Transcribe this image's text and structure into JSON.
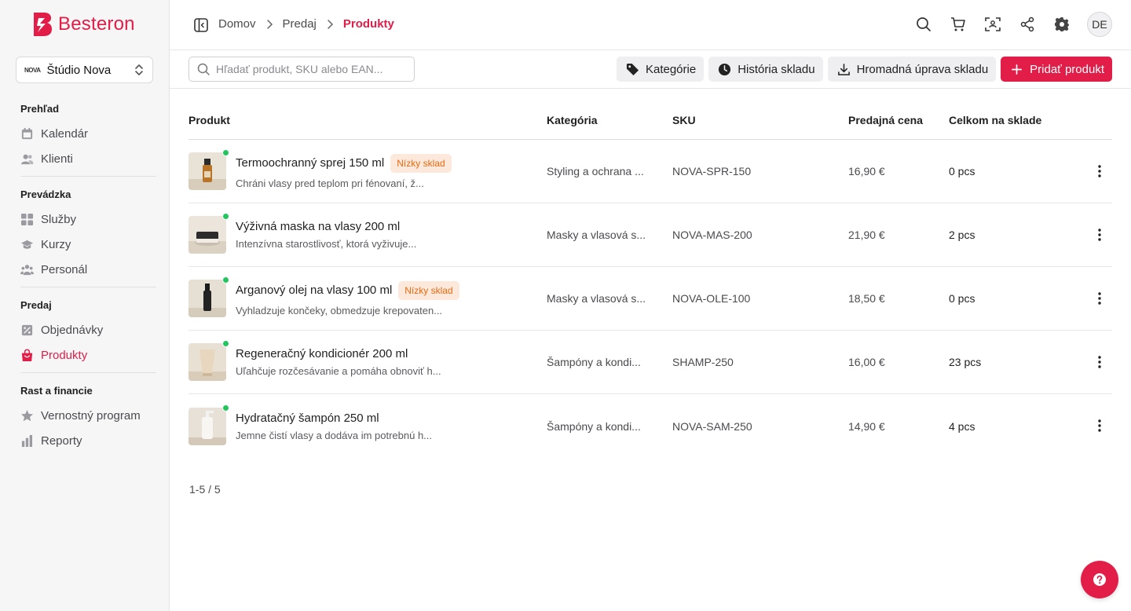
{
  "app": {
    "brand": "Besteron",
    "brand_color": "#e11d48"
  },
  "studio": {
    "logo_text": "NOVA",
    "name": "Štúdio Nova"
  },
  "sidebar": {
    "sections": [
      {
        "title": "Prehľad",
        "items": [
          {
            "label": "Kalendár",
            "icon": "calendar-icon"
          },
          {
            "label": "Klienti",
            "icon": "users-icon"
          }
        ]
      },
      {
        "title": "Prevádzka",
        "items": [
          {
            "label": "Služby",
            "icon": "grid-icon"
          },
          {
            "label": "Kurzy",
            "icon": "graduation-icon"
          },
          {
            "label": "Personál",
            "icon": "team-icon"
          }
        ]
      },
      {
        "title": "Predaj",
        "items": [
          {
            "label": "Objednávky",
            "icon": "orders-icon"
          },
          {
            "label": "Produkty",
            "icon": "shopping-bag-icon",
            "active": true
          }
        ]
      },
      {
        "title": "Rast a financie",
        "items": [
          {
            "label": "Vernostný program",
            "icon": "star-icon"
          },
          {
            "label": "Reporty",
            "icon": "bar-chart-icon"
          }
        ]
      }
    ]
  },
  "breadcrumb": {
    "items": [
      "Domov",
      "Predaj"
    ],
    "current": "Produkty"
  },
  "user": {
    "initials": "DE"
  },
  "toolbar": {
    "search_placeholder": "Hľadať produkt, SKU alebo EAN...",
    "categories_label": "Kategórie",
    "history_label": "História skladu",
    "bulk_label": "Hromadná úprava skladu",
    "add_label": "Pridať produkt"
  },
  "table": {
    "columns": [
      "Produkt",
      "Kategória",
      "SKU",
      "Predajná cena",
      "Celkom na sklade"
    ],
    "rows": [
      {
        "name": "Termoochranný sprej 150 ml",
        "badge": "Nízky sklad",
        "desc": "Chráni vlasy pred teplom pri fénovaní, ž...",
        "category": "Styling a ochrana ...",
        "sku": "NOVA-SPR-150",
        "price": "16,90 €",
        "stock": "0 pcs",
        "thumb": "spray-bottle"
      },
      {
        "name": "Výživná maska na vlasy 200 ml",
        "badge": "",
        "desc": "Intenzívna starostlivosť, ktorá vyživuje...",
        "category": "Masky a vlasová s...",
        "sku": "NOVA-MAS-200",
        "price": "21,90 €",
        "stock": "2 pcs",
        "thumb": "jar"
      },
      {
        "name": "Arganový olej na vlasy 100 ml",
        "badge": "Nízky sklad",
        "desc": "Vyhladzuje končeky, obmedzuje krepovaten...",
        "category": "Masky a vlasová s...",
        "sku": "NOVA-OLE-100",
        "price": "18,50 €",
        "stock": "0 pcs",
        "thumb": "oil-bottle"
      },
      {
        "name": "Regeneračný kondicionér 200 ml",
        "badge": "",
        "desc": "Uľahčuje rozčesávanie a pomáha obnoviť h...",
        "category": "Šampóny a kondi...",
        "sku": "SHAMP-250",
        "price": "16,00 €",
        "stock": "23 pcs",
        "thumb": "tube"
      },
      {
        "name": "Hydratačný šampón 250 ml",
        "badge": "",
        "desc": "Jemne čistí vlasy a dodáva im potrebnú h...",
        "category": "Šampóny a kondi...",
        "sku": "NOVA-SAM-250",
        "price": "14,90 €",
        "stock": "4 pcs",
        "thumb": "pump-bottle"
      }
    ]
  },
  "pager": {
    "text": "1-5 / 5"
  }
}
